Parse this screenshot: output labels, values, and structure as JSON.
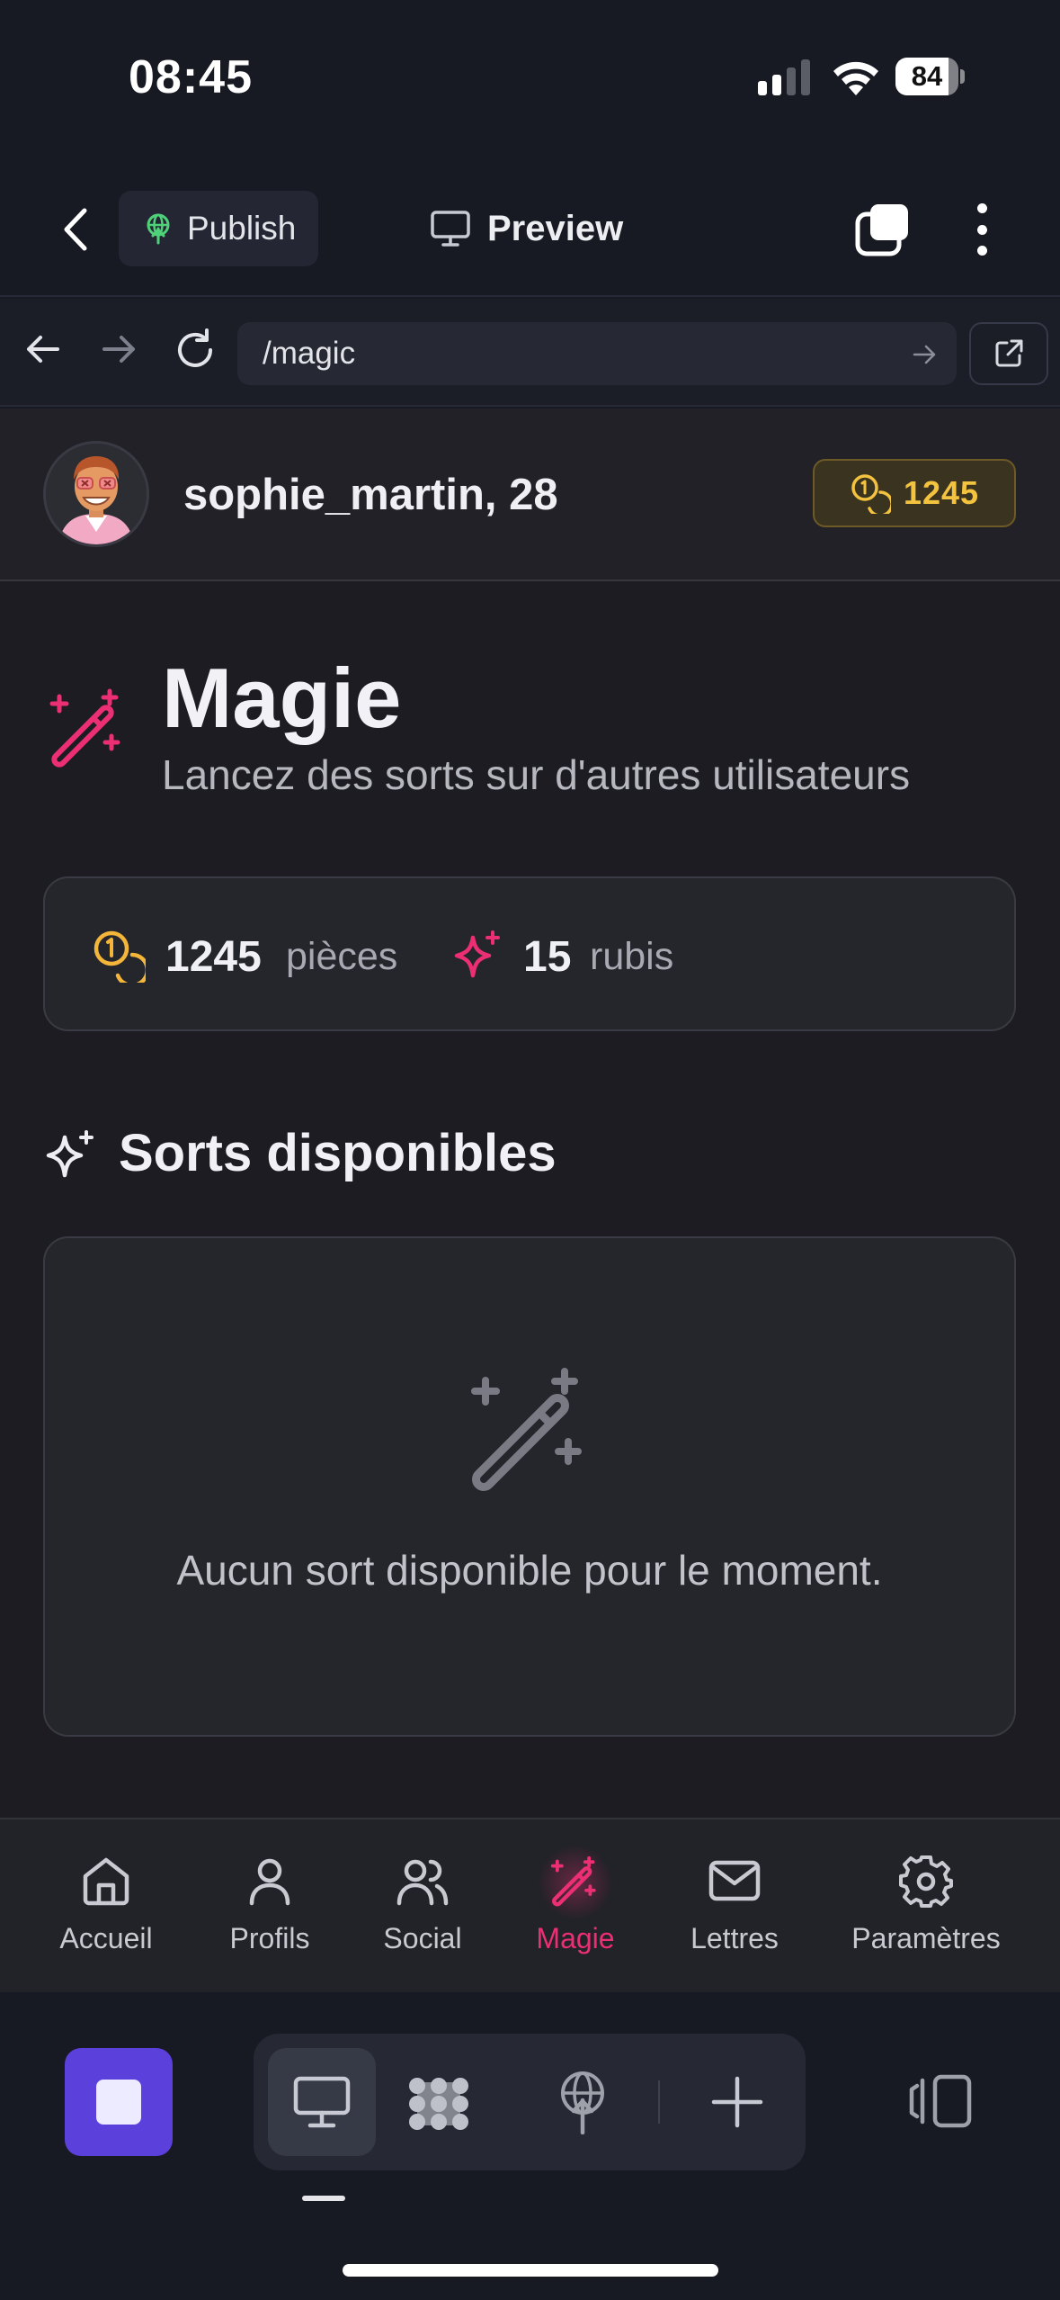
{
  "status_bar": {
    "time": "08:45",
    "battery_level": "84",
    "battery_fraction": 0.84
  },
  "top_bar": {
    "publish_label": "Publish",
    "preview_label": "Preview"
  },
  "browser": {
    "url": "/magic"
  },
  "profile": {
    "username": "sophie_martin, 28",
    "coins": "1245"
  },
  "page": {
    "title": "Magie",
    "subtitle": "Lancez des sorts sur d'autres utilisateurs"
  },
  "stats": {
    "coins_value": "1245",
    "coins_label": "pièces",
    "rubies_value": "15",
    "rubies_label": "rubis"
  },
  "spells": {
    "section_title": "Sorts disponibles",
    "empty_message": "Aucun sort disponible pour le moment."
  },
  "bottom_nav": {
    "items": [
      {
        "label": "Accueil",
        "icon": "home-icon"
      },
      {
        "label": "Profils",
        "icon": "user-icon"
      },
      {
        "label": "Social",
        "icon": "users-icon"
      },
      {
        "label": "Magie",
        "icon": "wand-icon",
        "active": true
      },
      {
        "label": "Lettres",
        "icon": "mail-icon"
      },
      {
        "label": "Paramètres",
        "icon": "gear-icon"
      }
    ]
  },
  "colors": {
    "accent": "#ec2f72",
    "coin": "#f3b63a",
    "editor_stop": "#5b40dc",
    "background": "#1c1c22"
  }
}
